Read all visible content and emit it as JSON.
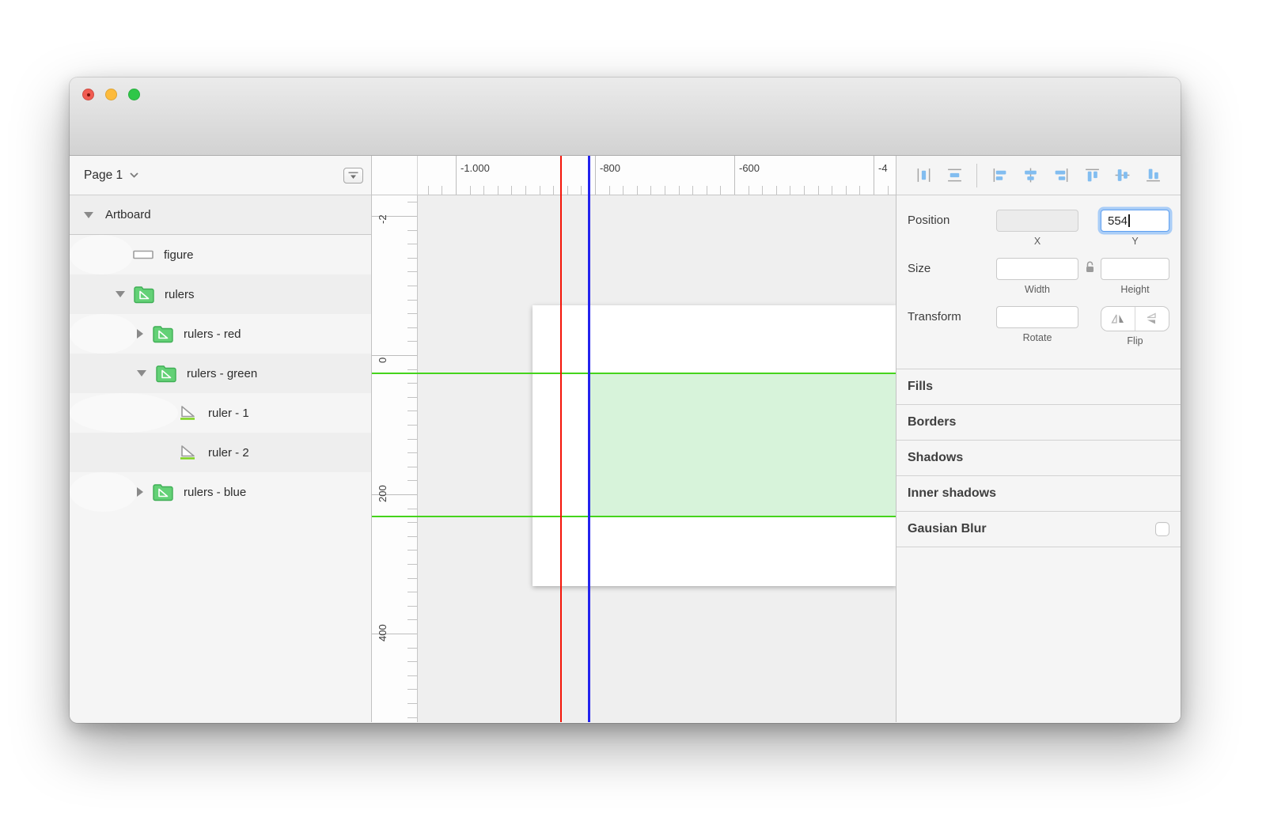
{
  "window": {
    "traffic_lights": {
      "close": "close",
      "minimize": "minimize",
      "zoom": "zoom"
    }
  },
  "sidebar": {
    "header": {
      "page_label": "Page 1"
    },
    "layers": [
      {
        "label": "Artboard",
        "type": "artboard",
        "disclosure": "expanded"
      },
      {
        "label": "figure",
        "type": "rect-layer"
      },
      {
        "label": "rulers",
        "type": "group",
        "disclosure": "expanded"
      },
      {
        "label": "rulers - red",
        "type": "group",
        "disclosure": "collapsed"
      },
      {
        "label": "rulers - green",
        "type": "group",
        "disclosure": "expanded"
      },
      {
        "label": "ruler - 1",
        "type": "shape"
      },
      {
        "label": "ruler - 2",
        "type": "shape"
      },
      {
        "label": "rulers - blue",
        "type": "group",
        "disclosure": "collapsed"
      }
    ]
  },
  "canvas": {
    "h_ruler_labels": [
      "-1.000",
      "-800",
      "-600",
      "-4"
    ],
    "v_ruler_labels": [
      "-2",
      "0",
      "200",
      "400"
    ],
    "colors": {
      "red_guide": "#f41408",
      "blue_guide": "#2323ee",
      "green_guide": "#45d41c",
      "green_fill": "#d7f3da"
    }
  },
  "inspector": {
    "toolbar_icons": [
      "distribute-horizontally",
      "distribute-vertically",
      "align-left",
      "align-center-horizontally",
      "align-right",
      "align-top",
      "align-middle-vertically",
      "align-bottom"
    ],
    "position": {
      "label": "Position",
      "x_value": "",
      "y_value": "554",
      "x_label": "X",
      "y_label": "Y"
    },
    "size": {
      "label": "Size",
      "width_value": "",
      "height_value": "",
      "width_label": "Width",
      "height_label": "Height"
    },
    "transform": {
      "label": "Transform",
      "rotate_value": "",
      "rotate_label": "Rotate",
      "flip_label": "Flip"
    },
    "sections": [
      {
        "label": "Fills"
      },
      {
        "label": "Borders"
      },
      {
        "label": "Shadows"
      },
      {
        "label": "Inner shadows"
      },
      {
        "label": "Gausian Blur",
        "checkbox": "unchecked"
      }
    ]
  }
}
